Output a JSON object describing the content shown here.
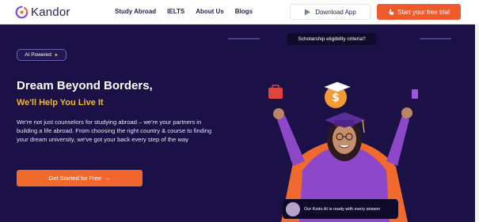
{
  "brand": {
    "name": "Kandor"
  },
  "nav": {
    "links": [
      "Study Abroad",
      "IELTS",
      "About Us",
      "Blogs"
    ],
    "download_label": "Download App",
    "trial_label": "Start your free trial"
  },
  "hero": {
    "badge": "AI Powered",
    "headline": "Dream Beyond Borders,",
    "subheadline": "We'll Help You Live It",
    "description": "We're not just counselors for studying abroad – we're your partners in building a life abroad. From choosing the right country & course to finding your dream university, we've got your back every step of the way",
    "cta_label": "Get Started for Free",
    "cta_arrow": "→",
    "scholarship_label": "Scholarship eligibility criteria?",
    "kodo_message": "Our Kodo AI is ready with every answer"
  },
  "colors": {
    "hero_bg": "#1b1146",
    "accent_orange": "#ef5a2c",
    "highlight_yellow": "#f5b82a",
    "nav_text": "#2b2150"
  },
  "icons": [
    "kandor-logo-icon",
    "play-store-icon",
    "hand-pointer-icon",
    "sparkle-icon",
    "arrow-right-icon"
  ]
}
